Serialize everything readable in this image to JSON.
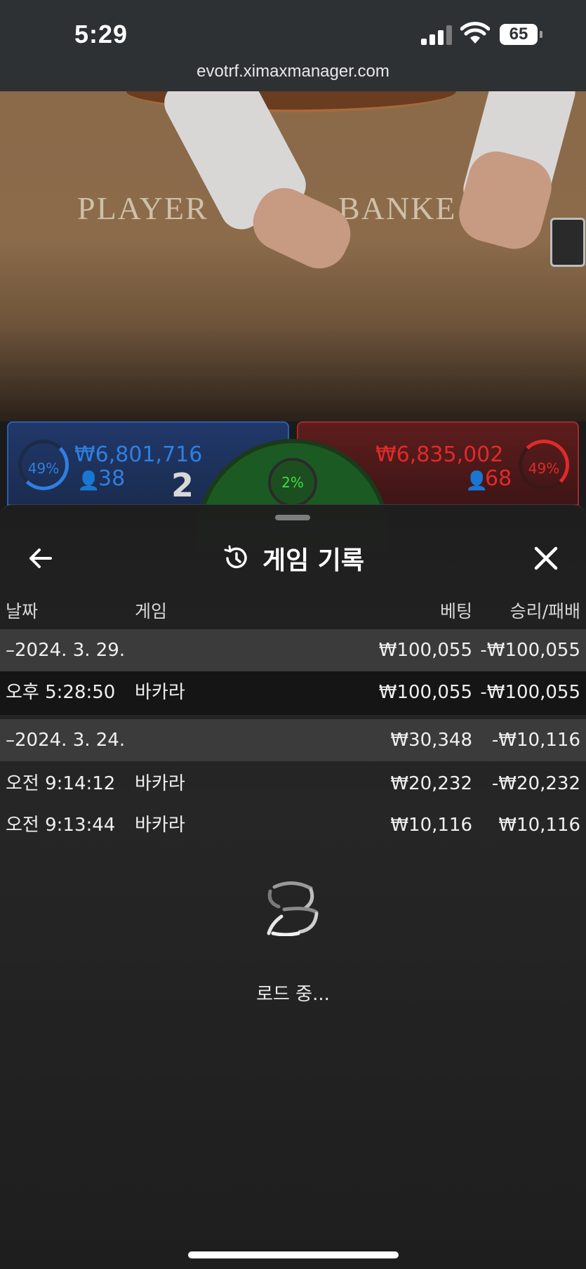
{
  "status_bar": {
    "time": "5:29",
    "battery": "65",
    "url": "evotrf.ximaxmanager.com"
  },
  "video": {
    "table_player": "PLAYER",
    "table_banker": "BANKE"
  },
  "player": {
    "percent": "49%",
    "amount": "₩6,801,716",
    "bettors": "38",
    "score": "2",
    "color": "#2f7fe0"
  },
  "banker": {
    "percent": "49%",
    "amount": "₩6,835,002",
    "bettors": "68",
    "color": "#e02a2a"
  },
  "tie": {
    "percent": "2%",
    "color": "#3adf4a"
  },
  "sheet": {
    "title": "게임 기록",
    "back_icon": "arrow-left-icon",
    "history_icon": "history-icon",
    "close_icon": "close-icon",
    "columns": {
      "date": "날짜",
      "game": "게임",
      "bet": "베팅",
      "winloss": "승리/패배"
    },
    "rows": [
      {
        "type": "date",
        "date": "–2024. 3. 29.",
        "game": "",
        "bet": "₩100,055",
        "winloss": "-₩100,055"
      },
      {
        "type": "entry",
        "date": "오후 5:28:50",
        "game": "바카라",
        "bet": "₩100,055",
        "winloss": "-₩100,055"
      },
      {
        "type": "date",
        "date": "–2024. 3. 24.",
        "game": "",
        "bet": "₩30,348",
        "winloss": "-₩10,116"
      },
      {
        "type": "entry",
        "date": "오전 9:14:12",
        "game": "바카라",
        "bet": "₩20,232",
        "winloss": "-₩20,232"
      },
      {
        "type": "entry",
        "date": "오전 9:13:44",
        "game": "바카라",
        "bet": "₩10,116",
        "winloss": "₩10,116"
      }
    ],
    "loading": "로드 중..."
  }
}
